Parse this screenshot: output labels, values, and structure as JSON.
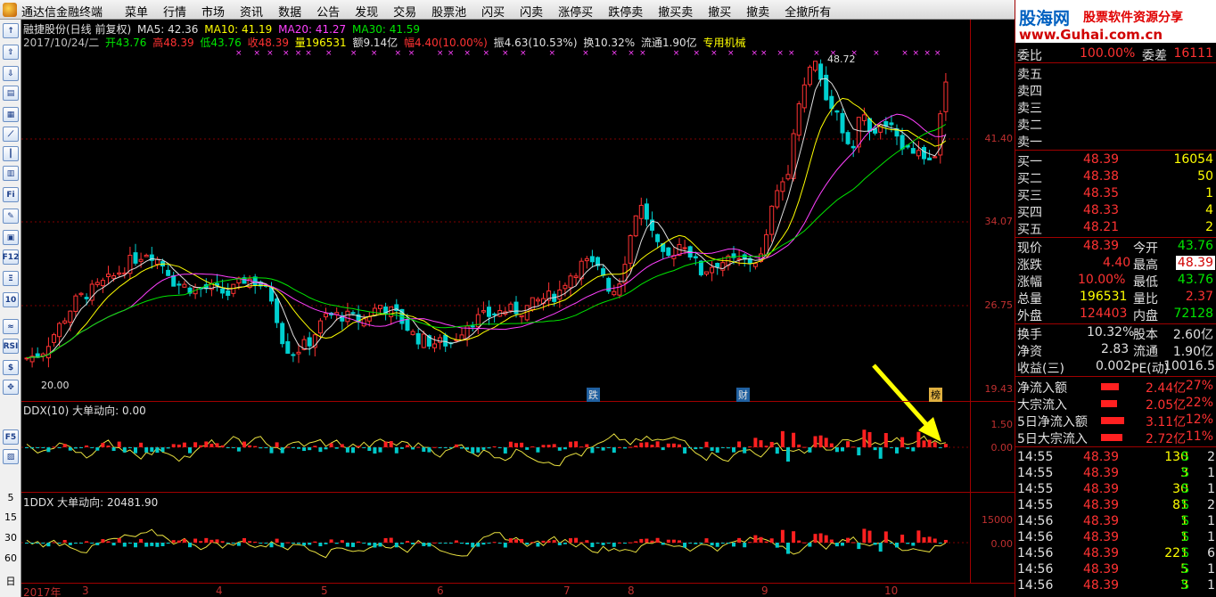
{
  "menubar": {
    "app_title": "通达信金融终端",
    "items": [
      "菜单",
      "行情",
      "市场",
      "资讯",
      "数据",
      "公告",
      "发现",
      "交易",
      "股票池",
      "闪买",
      "闪卖",
      "涨停买",
      "跌停卖",
      "撤买卖",
      "撤买",
      "撤卖",
      "全撤所有"
    ]
  },
  "left_toolbar": {
    "icons": [
      "arrow-up",
      "arrow-up",
      "arrow-down",
      "info",
      "table",
      "grid",
      "line",
      "candle",
      "bars",
      "list",
      "F10",
      "note",
      "bookmark",
      "F12",
      "xi",
      "F10b",
      "price",
      "RSI",
      "dollar",
      "move",
      "F5",
      "board"
    ],
    "labels": [
      "RSI",
      "F5",
      "F10",
      "F12"
    ],
    "periods": [
      "5",
      "15",
      "30",
      "60",
      "日"
    ]
  },
  "header": {
    "title": "融捷股份(日线 前复权)",
    "ma5": "MA5: 42.36",
    "ma10": "MA10: 41.19",
    "ma20": "MA20: 41.27",
    "ma30": "MA30: 41.59",
    "date": "2017/10/24/二",
    "open": "开43.76",
    "high": "高48.39",
    "low": "低43.76",
    "close": "收48.39",
    "vol": "量196531",
    "amount": "额9.14亿",
    "change": "幅4.40(10.00%)",
    "amplitude": "振4.63(10.53%)",
    "turnover": "换10.32%",
    "float": "流通1.90亿",
    "industry": "专用机械"
  },
  "price_axis": [
    "41.40",
    "34.07",
    "26.75",
    "19.43"
  ],
  "max_label": "48.72",
  "min_label": "20.00",
  "markers": [
    "跌",
    "财",
    "榜"
  ],
  "ddx": {
    "title": "DDX(10)  大单动向: 0.00",
    "axis": [
      "1.50",
      "0.00"
    ]
  },
  "ddx2": {
    "title": "1DDX  大单动向: 20481.90",
    "axis": [
      "15000",
      "0.00"
    ]
  },
  "bottom_axis": [
    "2017年",
    "3",
    "4",
    "5",
    "6",
    "7",
    "8",
    "9",
    "10"
  ],
  "banner": {
    "line1": "股海网",
    "line2": "股票软件资源分享",
    "line3": "www.Guhai.com.cn"
  },
  "quote": {
    "weibi_label": "委比",
    "weibi": "100.00%",
    "weicha_label": "委差",
    "weicha": "16111",
    "sells": [
      {
        "l": "卖五"
      },
      {
        "l": "卖四"
      },
      {
        "l": "卖三"
      },
      {
        "l": "卖二"
      },
      {
        "l": "卖一"
      }
    ],
    "buys": [
      {
        "l": "买一",
        "p": "48.39",
        "v": "16054"
      },
      {
        "l": "买二",
        "p": "48.38",
        "v": "50"
      },
      {
        "l": "买三",
        "p": "48.35",
        "v": "1"
      },
      {
        "l": "买四",
        "p": "48.33",
        "v": "4"
      },
      {
        "l": "买五",
        "p": "48.21",
        "v": "2"
      }
    ],
    "stats": [
      {
        "l1": "现价",
        "v1": "48.39",
        "l2": "今开",
        "v2": "43.76"
      },
      {
        "l1": "涨跌",
        "v1": "4.40",
        "l2": "最高",
        "v2": "48.39"
      },
      {
        "l1": "涨幅",
        "v1": "10.00%",
        "l2": "最低",
        "v2": "43.76"
      },
      {
        "l1": "总量",
        "v1": "196531",
        "l2": "量比",
        "v2": "2.37"
      },
      {
        "l1": "外盘",
        "v1": "124403",
        "l2": "内盘",
        "v2": "72128"
      }
    ],
    "fund": [
      {
        "l1": "换手",
        "v1": "10.32%",
        "l2": "股本",
        "v2": "2.60亿"
      },
      {
        "l1": "净资",
        "v1": "2.83",
        "l2": "流通",
        "v2": "1.90亿"
      },
      {
        "l1": "收益(三)",
        "v1": "0.002",
        "l2": "PE(动)",
        "v2": "10016.5"
      }
    ],
    "flows": [
      {
        "l": "净流入额",
        "v": "2.44亿",
        "p": "27%"
      },
      {
        "l": "大宗流入",
        "v": "2.05亿",
        "p": "22%"
      },
      {
        "l": "5日净流入额",
        "v": "3.11亿",
        "p": "12%"
      },
      {
        "l": "5日大宗流入",
        "v": "2.72亿",
        "p": "11%"
      }
    ],
    "ticks": [
      {
        "t": "14:55",
        "p": "48.39",
        "v": "130",
        "s": "S",
        "n": "2"
      },
      {
        "t": "14:55",
        "p": "48.39",
        "v": "3",
        "s": "S",
        "n": "1"
      },
      {
        "t": "14:55",
        "p": "48.39",
        "v": "30",
        "s": "S",
        "n": "1"
      },
      {
        "t": "14:55",
        "p": "48.39",
        "v": "81",
        "s": "S",
        "n": "2"
      },
      {
        "t": "14:56",
        "p": "48.39",
        "v": "1",
        "s": "S",
        "n": "1"
      },
      {
        "t": "14:56",
        "p": "48.39",
        "v": "1",
        "s": "S",
        "n": "1"
      },
      {
        "t": "14:56",
        "p": "48.39",
        "v": "221",
        "s": "S",
        "n": "6"
      },
      {
        "t": "14:56",
        "p": "48.39",
        "v": "5",
        "s": "S",
        "n": "1"
      },
      {
        "t": "14:56",
        "p": "48.39",
        "v": "3",
        "s": "S",
        "n": "1"
      }
    ]
  }
}
